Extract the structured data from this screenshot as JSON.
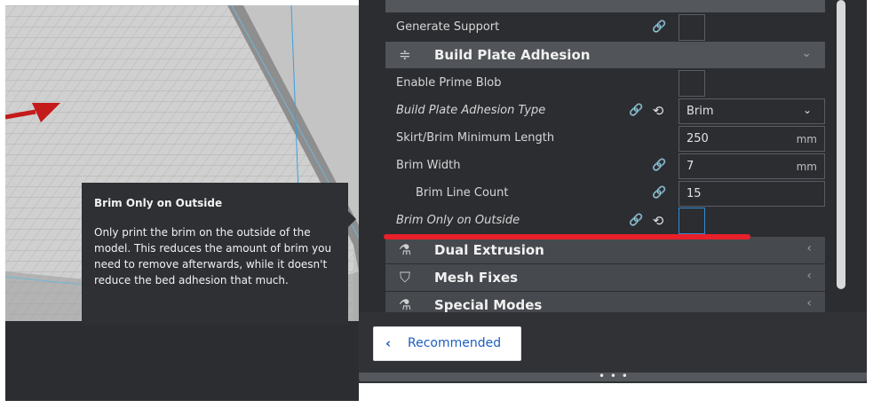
{
  "tooltip": {
    "title": "Brim Only on Outside",
    "body": "Only print the brim on the outside of the model. This reduces the amount of brim you need to remove afterwards, while it doesn't reduce the bed adhesion that much."
  },
  "settings": {
    "generate_support": {
      "label": "Generate Support",
      "icon": "link-icon"
    },
    "build_plate_adhesion": {
      "label": "Build Plate Adhesion",
      "icon": "adhesion-icon"
    },
    "enable_prime_blob": {
      "label": "Enable Prime Blob"
    },
    "adhesion_type": {
      "label": "Build Plate Adhesion Type",
      "value": "Brim"
    },
    "skirt_brim_min_length": {
      "label": "Skirt/Brim Minimum Length",
      "value": "250",
      "unit": "mm"
    },
    "brim_width": {
      "label": "Brim Width",
      "value": "7",
      "unit": "mm"
    },
    "brim_line_count": {
      "label": "Brim Line Count",
      "value": "15"
    },
    "brim_only_outside": {
      "label": "Brim Only on Outside",
      "checked": false
    }
  },
  "sections": {
    "dual_extrusion": "Dual Extrusion",
    "mesh_fixes": "Mesh Fixes",
    "special_modes": "Special Modes"
  },
  "recommended_button": "Recommended",
  "icons": {
    "link": "🔗",
    "reset": "⟲",
    "chevron_down": "⌄",
    "chevron_left": "‹"
  },
  "colors": {
    "panel_bg": "#2b2d31",
    "section_bg": "#46494e",
    "accent_blue": "#2f8bd6",
    "annotation_red": "#e8202a",
    "button_text": "#1b5dbf"
  }
}
